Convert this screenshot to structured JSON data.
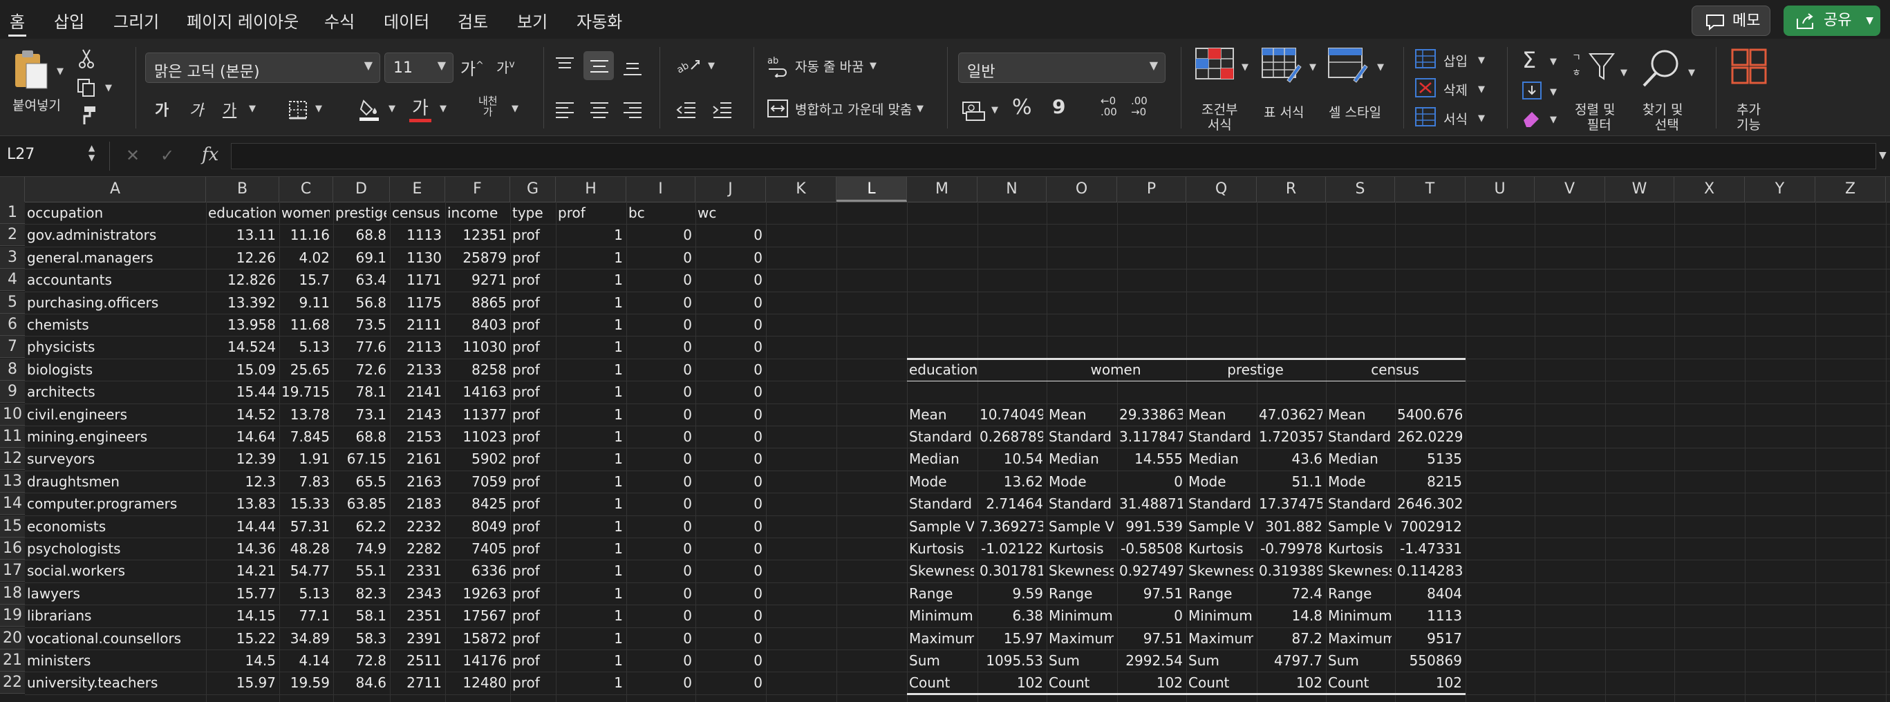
{
  "tabs": [
    "홈",
    "삽입",
    "그리기",
    "페이지 레이아웃",
    "수식",
    "데이터",
    "검토",
    "보기",
    "자동화"
  ],
  "memo_label": "메모",
  "share_label": "공유",
  "ribbon": {
    "paste_label": "붙여넣기",
    "font_name": "맑은 고딕 (본문)",
    "font_size": "11",
    "bold": "가",
    "italic": "가",
    "underline": "가",
    "font_color_glyph": "가",
    "wrap_text": "자동 줄 바꿈",
    "merge_center": "병합하고 가운데 맞춤",
    "number_format": "일반",
    "percent": "%",
    "comma": "9",
    "conditional_format": [
      "조건부",
      "서식"
    ],
    "table_format": "표 서식",
    "cell_style": "셀 스타일",
    "insert": "삽입",
    "delete": "삭제",
    "format": "서식",
    "sort_filter": [
      "정렬 및",
      "필터"
    ],
    "find_select": [
      "찾기 및",
      "선택"
    ],
    "addins": [
      "추가",
      "기능"
    ],
    "phonetic": "내천",
    "phonetic_sub": "가",
    "font_grow": "가",
    "font_shrink": "가",
    "orient": "ab",
    "wrap_icon": "ab",
    "dec_inc": [
      "←0",
      ".00"
    ],
    "dec_dec": [
      ".00",
      "→0"
    ],
    "sigma": "Σ",
    "color_hex": {
      "red": "#e03030",
      "green": "#2e8b4a",
      "orange": "#e05a3a",
      "blue": "#3e7bd6"
    }
  },
  "formula_bar": {
    "cell_ref": "L27",
    "fx": "fx",
    "cancel": "✕",
    "enter": "✓",
    "value": ""
  },
  "columns": [
    "A",
    "B",
    "C",
    "D",
    "E",
    "F",
    "G",
    "H",
    "I",
    "J",
    "K",
    "L",
    "M",
    "N",
    "O",
    "P",
    "Q",
    "R",
    "S",
    "T",
    "U",
    "V",
    "W",
    "X",
    "Y",
    "Z"
  ],
  "selected_column": "L",
  "rows": [
    "1",
    "2",
    "3",
    "4",
    "5",
    "6",
    "7",
    "8",
    "9",
    "10",
    "11",
    "12",
    "13",
    "14",
    "15",
    "16",
    "17",
    "18",
    "19",
    "20",
    "21",
    "22"
  ],
  "headers": [
    "occupation",
    "education",
    "women",
    "prestige",
    "census",
    "income",
    "type",
    "prof",
    "bc",
    "wc"
  ],
  "records": [
    [
      "gov.administrators",
      "13.11",
      "11.16",
      "68.8",
      "1113",
      "12351",
      "prof",
      "1",
      "0",
      "0"
    ],
    [
      "general.managers",
      "12.26",
      "4.02",
      "69.1",
      "1130",
      "25879",
      "prof",
      "1",
      "0",
      "0"
    ],
    [
      "accountants",
      "12.826",
      "15.7",
      "63.4",
      "1171",
      "9271",
      "prof",
      "1",
      "0",
      "0"
    ],
    [
      "purchasing.officers",
      "13.392",
      "9.11",
      "56.8",
      "1175",
      "8865",
      "prof",
      "1",
      "0",
      "0"
    ],
    [
      "chemists",
      "13.958",
      "11.68",
      "73.5",
      "2111",
      "8403",
      "prof",
      "1",
      "0",
      "0"
    ],
    [
      "physicists",
      "14.524",
      "5.13",
      "77.6",
      "2113",
      "11030",
      "prof",
      "1",
      "0",
      "0"
    ],
    [
      "biologists",
      "15.09",
      "25.65",
      "72.6",
      "2133",
      "8258",
      "prof",
      "1",
      "0",
      "0"
    ],
    [
      "architects",
      "15.44",
      "19.715",
      "78.1",
      "2141",
      "14163",
      "prof",
      "1",
      "0",
      "0"
    ],
    [
      "civil.engineers",
      "14.52",
      "13.78",
      "73.1",
      "2143",
      "11377",
      "prof",
      "1",
      "0",
      "0"
    ],
    [
      "mining.engineers",
      "14.64",
      "7.845",
      "68.8",
      "2153",
      "11023",
      "prof",
      "1",
      "0",
      "0"
    ],
    [
      "surveyors",
      "12.39",
      "1.91",
      "67.15",
      "2161",
      "5902",
      "prof",
      "1",
      "0",
      "0"
    ],
    [
      "draughtsmen",
      "12.3",
      "7.83",
      "65.5",
      "2163",
      "7059",
      "prof",
      "1",
      "0",
      "0"
    ],
    [
      "computer.programers",
      "13.83",
      "15.33",
      "63.85",
      "2183",
      "8425",
      "prof",
      "1",
      "0",
      "0"
    ],
    [
      "economists",
      "14.44",
      "57.31",
      "62.2",
      "2232",
      "8049",
      "prof",
      "1",
      "0",
      "0"
    ],
    [
      "psychologists",
      "14.36",
      "48.28",
      "74.9",
      "2282",
      "7405",
      "prof",
      "1",
      "0",
      "0"
    ],
    [
      "social.workers",
      "14.21",
      "54.77",
      "55.1",
      "2331",
      "6336",
      "prof",
      "1",
      "0",
      "0"
    ],
    [
      "lawyers",
      "15.77",
      "5.13",
      "82.3",
      "2343",
      "19263",
      "prof",
      "1",
      "0",
      "0"
    ],
    [
      "librarians",
      "14.15",
      "77.1",
      "58.1",
      "2351",
      "17567",
      "prof",
      "1",
      "0",
      "0"
    ],
    [
      "vocational.counsellors",
      "15.22",
      "34.89",
      "58.3",
      "2391",
      "15872",
      "prof",
      "1",
      "0",
      "0"
    ],
    [
      "ministers",
      "14.5",
      "4.14",
      "72.8",
      "2511",
      "14176",
      "prof",
      "1",
      "0",
      "0"
    ],
    [
      "university.teachers",
      "15.97",
      "19.59",
      "84.6",
      "2711",
      "12480",
      "prof",
      "1",
      "0",
      "0"
    ]
  ],
  "stats": {
    "groups": [
      "education",
      "women",
      "prestige",
      "census"
    ],
    "labels": [
      "Mean",
      "Standard",
      "Median",
      "Mode",
      "Standard",
      "Sample V.",
      "Kurtosis",
      "Skewness",
      "Range",
      "Minimum",
      "Maximum",
      "Sum",
      "Count"
    ],
    "values": [
      [
        "10.74049",
        "0.268789",
        "10.54",
        "13.62",
        "2.71464",
        "7.369273",
        "-1.02122",
        "0.301781",
        "9.59",
        "6.38",
        "15.97",
        "1095.53",
        "102"
      ],
      [
        "29.33863",
        "3.117847",
        "14.555",
        "0",
        "31.48871",
        "991.539",
        "-0.58508",
        "0.927497",
        "97.51",
        "0",
        "97.51",
        "2992.54",
        "102"
      ],
      [
        "47.03627",
        "1.720357",
        "43.6",
        "51.1",
        "17.37475",
        "301.882",
        "-0.79978",
        "0.319389",
        "72.4",
        "14.8",
        "87.2",
        "4797.7",
        "102"
      ],
      [
        "5400.676",
        "262.0229",
        "5135",
        "8215",
        "2646.302",
        "7002912",
        "-1.47331",
        "0.114283",
        "8404",
        "1113",
        "9517",
        "550869",
        "102"
      ]
    ]
  }
}
